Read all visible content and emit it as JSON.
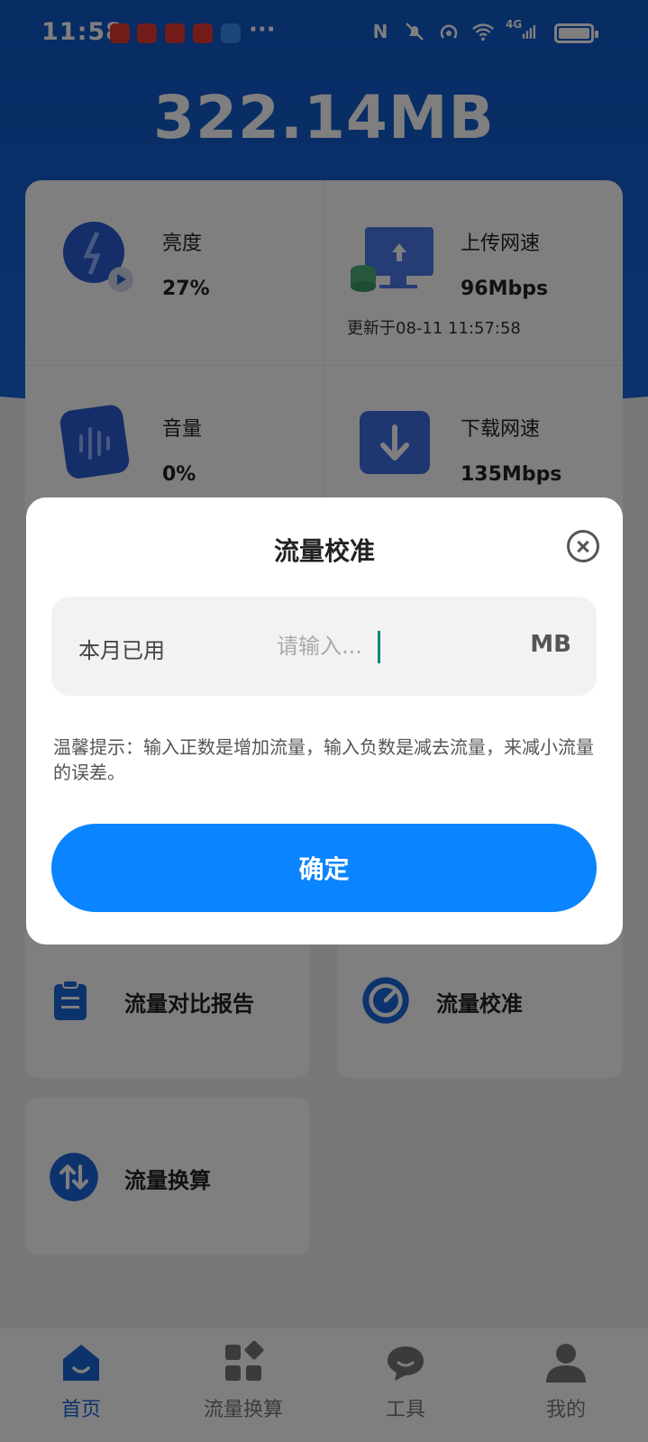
{
  "status_bar": {
    "time": "11:58",
    "network": "4G",
    "more": "···"
  },
  "header": {
    "usage": "322.14MB"
  },
  "stats": {
    "brightness": {
      "label": "亮度",
      "value": "27%"
    },
    "upload": {
      "label": "上传网速",
      "value": "96Mbps",
      "updated": "更新于08-11 11:57:58"
    },
    "volume": {
      "label": "音量",
      "value": "0%"
    },
    "download": {
      "label": "下载网速",
      "value": "135Mbps"
    }
  },
  "tiles": {
    "compare_report": "流量对比报告",
    "calibration": "流量校准",
    "conversion": "流量换算"
  },
  "bottom_nav": {
    "items": [
      {
        "label": "首页",
        "icon": "home-icon",
        "active": true
      },
      {
        "label": "流量换算",
        "icon": "apps-icon",
        "active": false
      },
      {
        "label": "工具",
        "icon": "chat-icon",
        "active": false
      },
      {
        "label": "我的",
        "icon": "person-icon",
        "active": false
      }
    ]
  },
  "dialog": {
    "title": "流量校准",
    "field_label": "本月已用",
    "field_value": "",
    "field_placeholder": "请输入...",
    "field_unit": "MB",
    "tip": "温馨提示：输入正数是增加流量，输入负数是减去流量，来减小流量的误差。",
    "confirm_label": "确定"
  },
  "colors": {
    "brand_blue": "#1a66da",
    "confirm_blue": "#0a84ff"
  }
}
